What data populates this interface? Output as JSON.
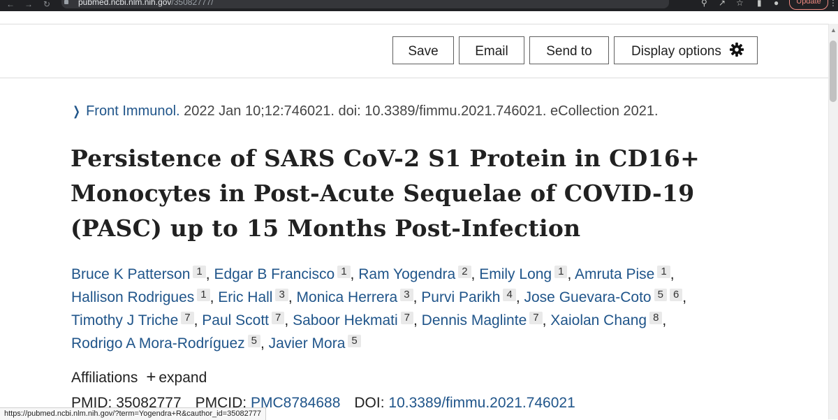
{
  "browser": {
    "url_host": "pubmed.ncbi.nlm.nih.gov",
    "url_path": "/35082777/",
    "update_label": "Update"
  },
  "toolbar": {
    "save_label": "Save",
    "email_label": "Email",
    "send_to_label": "Send to",
    "display_options_label": "Display options"
  },
  "citation": {
    "journal": "Front Immunol.",
    "details": " 2022 Jan 10;12:746021. doi: 10.3389/fimmu.2021.746021. eCollection 2021."
  },
  "article": {
    "title": "Persistence of SARS CoV-2 S1 Protein in CD16+ Monocytes in Post-Acute Sequelae of COVID-19 (PASC) up to 15 Months Post-Infection"
  },
  "authors": [
    {
      "name": "Bruce K Patterson",
      "affs": [
        "1"
      ]
    },
    {
      "name": "Edgar B Francisco",
      "affs": [
        "1"
      ]
    },
    {
      "name": "Ram Yogendra",
      "affs": [
        "2"
      ]
    },
    {
      "name": "Emily Long",
      "affs": [
        "1"
      ]
    },
    {
      "name": "Amruta Pise",
      "affs": [
        "1"
      ]
    },
    {
      "name": "Hallison Rodrigues",
      "affs": [
        "1"
      ]
    },
    {
      "name": "Eric Hall",
      "affs": [
        "3"
      ]
    },
    {
      "name": "Monica Herrera",
      "affs": [
        "3"
      ]
    },
    {
      "name": "Purvi Parikh",
      "affs": [
        "4"
      ]
    },
    {
      "name": "Jose Guevara-Coto",
      "affs": [
        "5",
        "6"
      ]
    },
    {
      "name": "Timothy J Triche",
      "affs": [
        "7"
      ]
    },
    {
      "name": "Paul Scott",
      "affs": [
        "7"
      ]
    },
    {
      "name": "Saboor Hekmati",
      "affs": [
        "7"
      ]
    },
    {
      "name": "Dennis Maglinte",
      "affs": [
        "7"
      ]
    },
    {
      "name": "Xaiolan Chang",
      "affs": [
        "8"
      ]
    },
    {
      "name": "Rodrigo A Mora-Rodríguez",
      "affs": [
        "5"
      ]
    },
    {
      "name": "Javier Mora",
      "affs": [
        "5"
      ]
    }
  ],
  "affiliations": {
    "label": "Affiliations",
    "expand_label": "expand"
  },
  "ids": {
    "pmid_label": "PMID:",
    "pmid": "35082777",
    "pmcid_label": "PMCID:",
    "pmcid": "PMC8784688",
    "doi_label": "DOI:",
    "doi": "10.3389/fimmu.2021.746021"
  },
  "status_bar": {
    "url": "https://pubmed.ncbi.nlm.nih.gov/?term=Yogendra+R&cauthor_id=35082777"
  },
  "icons": {
    "gear": "gear-icon",
    "chevron": "chevron-right-icon",
    "plus": "plus-icon"
  },
  "colors": {
    "link": "#20558a",
    "text": "#212121"
  }
}
